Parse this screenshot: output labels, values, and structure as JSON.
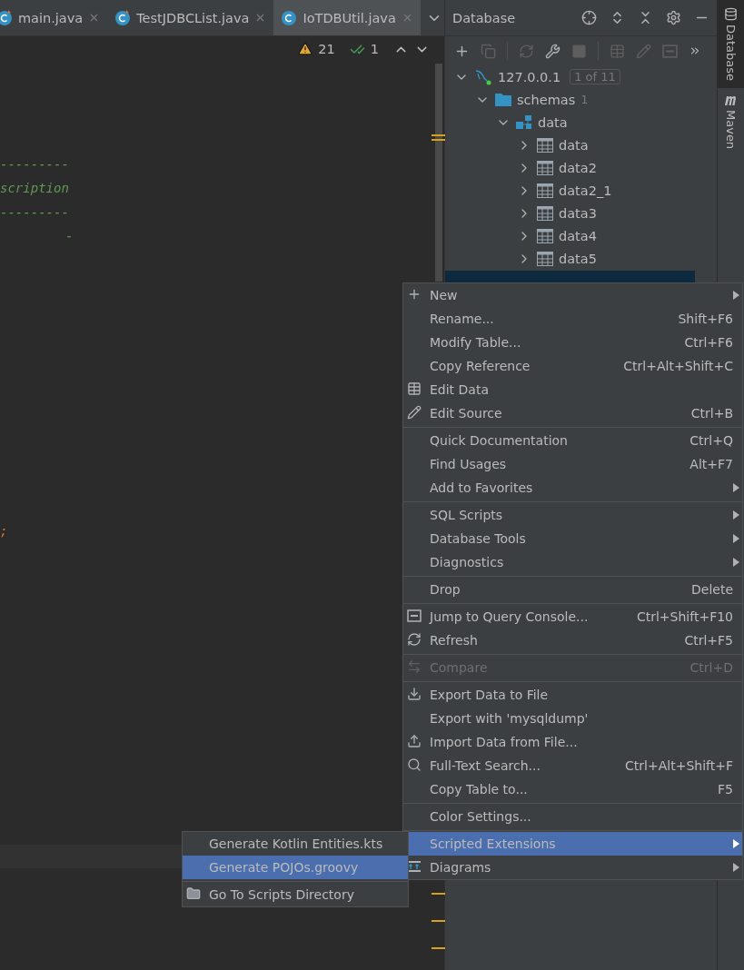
{
  "editor_tabs": [
    {
      "label": "main.java",
      "selected": false
    },
    {
      "label": "TestJDBCList.java",
      "selected": false
    },
    {
      "label": "IoTDBUtil.java",
      "selected": true
    }
  ],
  "inspections": {
    "warnings": "21",
    "weak_warnings": "1"
  },
  "code_blocks": [
    [
      {
        "text": "---------",
        "kind": "comment"
      },
      {
        "text": "scription",
        "kind": "comment"
      },
      {
        "text": "---------",
        "kind": "comment"
      },
      {
        "text": "-",
        "kind": "comment"
      }
    ],
    [
      {
        "text": ";",
        "kind": "keyword"
      }
    ]
  ],
  "database_panel": {
    "title": "Database",
    "tree": [
      {
        "label": "127.0.0.1",
        "kind": "server",
        "badge": "1 of 11",
        "expanded": true,
        "children": [
          {
            "label": "schemas",
            "kind": "folder",
            "count": "1",
            "expanded": true,
            "children": [
              {
                "label": "data",
                "kind": "schema",
                "expanded": true,
                "children": [
                  {
                    "label": "data",
                    "kind": "table",
                    "expanded": false
                  },
                  {
                    "label": "data2",
                    "kind": "table",
                    "expanded": false
                  },
                  {
                    "label": "data2_1",
                    "kind": "table",
                    "expanded": false
                  },
                  {
                    "label": "data3",
                    "kind": "table",
                    "expanded": false
                  },
                  {
                    "label": "data4",
                    "kind": "table",
                    "expanded": false
                  },
                  {
                    "label": "data5",
                    "kind": "table",
                    "expanded": false
                  }
                ]
              }
            ]
          }
        ]
      }
    ]
  },
  "side_tabs": [
    {
      "label": "Database",
      "selected": true
    },
    {
      "label": "Maven",
      "selected": false
    }
  ],
  "context_menu": [
    {
      "kind": "item",
      "label": "New",
      "submenu": true,
      "disabled": false,
      "selected": false
    },
    {
      "kind": "item",
      "label": "Rename...",
      "shortcut": "Shift+F6",
      "disabled": false,
      "selected": false
    },
    {
      "kind": "item",
      "label": "Modify Table...",
      "shortcut": "Ctrl+F6",
      "disabled": false,
      "selected": false
    },
    {
      "kind": "item",
      "label": "Copy Reference",
      "shortcut": "Ctrl+Alt+Shift+C",
      "disabled": false,
      "selected": false
    },
    {
      "kind": "item",
      "label": "Edit Data",
      "disabled": false,
      "selected": false
    },
    {
      "kind": "item",
      "label": "Edit Source",
      "shortcut": "Ctrl+B",
      "disabled": false,
      "selected": false
    },
    {
      "kind": "separator"
    },
    {
      "kind": "item",
      "label": "Quick Documentation",
      "shortcut": "Ctrl+Q",
      "disabled": false,
      "selected": false
    },
    {
      "kind": "item",
      "label": "Find Usages",
      "shortcut": "Alt+F7",
      "disabled": false,
      "selected": false
    },
    {
      "kind": "item",
      "label": "Add to Favorites",
      "submenu": true,
      "disabled": false,
      "selected": false
    },
    {
      "kind": "separator"
    },
    {
      "kind": "item",
      "label": "SQL Scripts",
      "submenu": true,
      "disabled": false,
      "selected": false
    },
    {
      "kind": "item",
      "label": "Database Tools",
      "submenu": true,
      "disabled": false,
      "selected": false
    },
    {
      "kind": "item",
      "label": "Diagnostics",
      "submenu": true,
      "disabled": false,
      "selected": false
    },
    {
      "kind": "separator"
    },
    {
      "kind": "item",
      "label": "Drop",
      "shortcut": "Delete",
      "disabled": false,
      "selected": false
    },
    {
      "kind": "separator"
    },
    {
      "kind": "item",
      "label": "Jump to Query Console...",
      "shortcut": "Ctrl+Shift+F10",
      "disabled": false,
      "selected": false
    },
    {
      "kind": "item",
      "label": "Refresh",
      "shortcut": "Ctrl+F5",
      "disabled": false,
      "selected": false
    },
    {
      "kind": "separator"
    },
    {
      "kind": "item",
      "label": "Compare",
      "shortcut": "Ctrl+D",
      "disabled": true,
      "selected": false
    },
    {
      "kind": "separator"
    },
    {
      "kind": "item",
      "label": "Export Data to File",
      "disabled": false,
      "selected": false
    },
    {
      "kind": "item",
      "label": "Export with 'mysqldump'",
      "disabled": false,
      "selected": false
    },
    {
      "kind": "item",
      "label": "Import Data from File...",
      "disabled": false,
      "selected": false
    },
    {
      "kind": "item",
      "label": "Full-Text Search...",
      "shortcut": "Ctrl+Alt+Shift+F",
      "disabled": false,
      "selected": false
    },
    {
      "kind": "item",
      "label": "Copy Table to...",
      "shortcut": "F5",
      "disabled": false,
      "selected": false
    },
    {
      "kind": "separator"
    },
    {
      "kind": "item",
      "label": "Color Settings...",
      "disabled": false,
      "selected": false
    },
    {
      "kind": "separator"
    },
    {
      "kind": "item",
      "label": "Scripted Extensions",
      "submenu": true,
      "disabled": false,
      "selected": true
    },
    {
      "kind": "item",
      "label": "Diagrams",
      "submenu": true,
      "disabled": false,
      "selected": false
    }
  ],
  "submenu": [
    {
      "kind": "item",
      "label": "Generate Kotlin Entities.kts",
      "disabled": false,
      "selected": false
    },
    {
      "kind": "item",
      "label": "Generate POJOs.groovy",
      "disabled": false,
      "selected": true
    },
    {
      "kind": "separator"
    },
    {
      "kind": "item",
      "label": "Go To Scripts Directory",
      "disabled": false,
      "selected": false
    }
  ]
}
